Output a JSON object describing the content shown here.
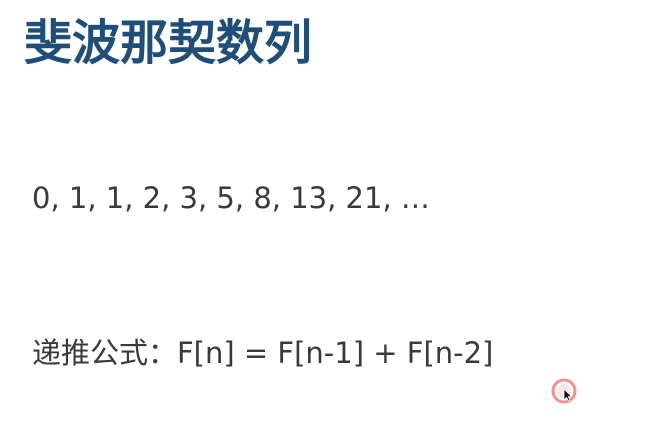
{
  "slide": {
    "title": "斐波那契数列",
    "sequence": "0, 1, 1, 2, 3, 5, 8, 13, 21, …",
    "formula": "递推公式：F[n] = F[n-1] + F[n-2]"
  },
  "colors": {
    "title": "#1f4e79",
    "body_text": "#3a3a3a",
    "cursor_ring": "#e53935"
  },
  "icons": {
    "cursor": "mouse-pointer-icon"
  }
}
